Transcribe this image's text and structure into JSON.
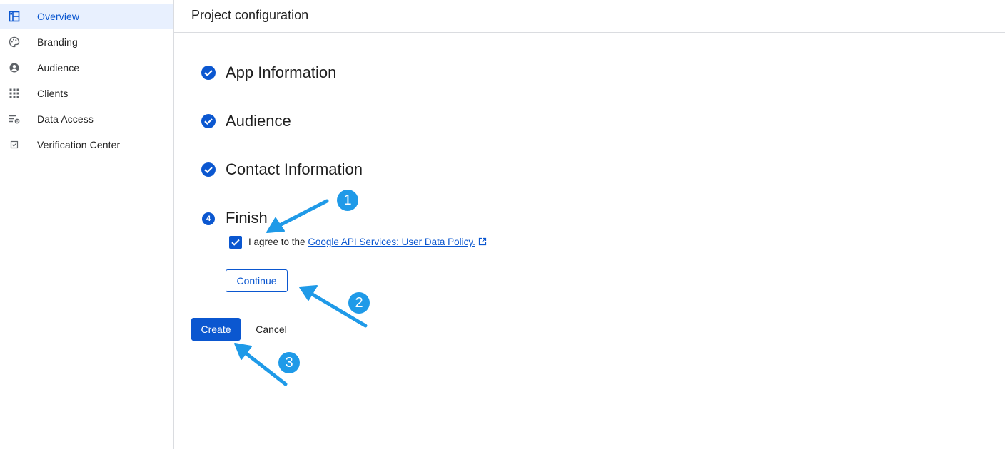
{
  "sidebar": {
    "items": [
      {
        "label": "Overview",
        "icon": "dashboard-icon",
        "active": true
      },
      {
        "label": "Branding",
        "icon": "palette-icon"
      },
      {
        "label": "Audience",
        "icon": "person-circle-icon"
      },
      {
        "label": "Clients",
        "icon": "apps-grid-icon"
      },
      {
        "label": "Data Access",
        "icon": "list-settings-icon"
      },
      {
        "label": "Verification Center",
        "icon": "checkbox-icon"
      }
    ]
  },
  "header": {
    "title": "Project configuration"
  },
  "stepper": {
    "steps": [
      {
        "title": "App Information",
        "status": "complete"
      },
      {
        "title": "Audience",
        "status": "complete"
      },
      {
        "title": "Contact Information",
        "status": "complete"
      },
      {
        "title": "Finish",
        "number": "4",
        "status": "current"
      }
    ]
  },
  "agreement": {
    "checked": true,
    "prefix": "I agree to the",
    "link_text": "Google API Services: User Data Policy."
  },
  "buttons": {
    "continue": "Continue",
    "create": "Create",
    "cancel": "Cancel"
  },
  "annotations": {
    "badges": [
      "1",
      "2",
      "3"
    ],
    "color": "#1f9ae8"
  },
  "colors": {
    "accent": "#0b57d0",
    "active_bg": "#e8f0fe",
    "divider": "#dadce0"
  }
}
